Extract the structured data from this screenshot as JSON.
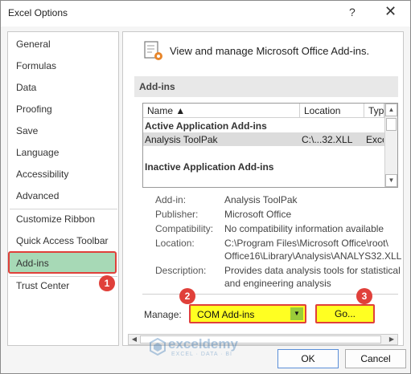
{
  "window": {
    "title": "Excel Options",
    "help_glyph": "?",
    "close_glyph": "✕"
  },
  "sidebar": {
    "items": [
      {
        "label": "General"
      },
      {
        "label": "Formulas"
      },
      {
        "label": "Data"
      },
      {
        "label": "Proofing"
      },
      {
        "label": "Save"
      },
      {
        "label": "Language"
      },
      {
        "label": "Accessibility"
      },
      {
        "label": "Advanced"
      },
      {
        "label": "Customize Ribbon"
      },
      {
        "label": "Quick Access Toolbar"
      },
      {
        "label": "Add-ins",
        "selected": true
      },
      {
        "label": "Trust Center"
      }
    ]
  },
  "main": {
    "header": "View and manage Microsoft Office Add-ins.",
    "header_icon": "addins-gear-icon",
    "section_title": "Add-ins",
    "grid": {
      "columns": [
        "Name ▲",
        "Location",
        "Type"
      ],
      "groups": [
        {
          "title": "Active Application Add-ins",
          "rows": [
            {
              "name": "Analysis ToolPak",
              "location": "C:\\...32.XLL",
              "type": "Exce"
            }
          ]
        },
        {
          "title": "Inactive Application Add-ins",
          "rows": []
        }
      ]
    },
    "details": {
      "addin_label": "Add-in:",
      "addin_value": "Analysis ToolPak",
      "publisher_label": "Publisher:",
      "publisher_value": "Microsoft Office",
      "compat_label": "Compatibility:",
      "compat_value": "No compatibility information available",
      "location_label": "Location:",
      "location_value_1": "C:\\Program Files\\Microsoft Office\\root\\",
      "location_value_2": "Office16\\Library\\Analysis\\ANALYS32.XLL",
      "desc_label": "Description:",
      "desc_value_1": "Provides data analysis tools for statistical",
      "desc_value_2": "and engineering analysis"
    },
    "manage": {
      "label": "Manage:",
      "selected": "COM Add-ins",
      "go_label": "Go..."
    }
  },
  "badges": [
    "1",
    "2",
    "3"
  ],
  "footer": {
    "ok_label": "OK",
    "cancel_label": "Cancel"
  },
  "watermark": {
    "name": "exceldemy",
    "tagline": "EXCEL · DATA · BI"
  },
  "colors": {
    "highlight": "#ffff22",
    "annotation_red": "#e0403a",
    "selected_nav": "#a7d9b6"
  }
}
